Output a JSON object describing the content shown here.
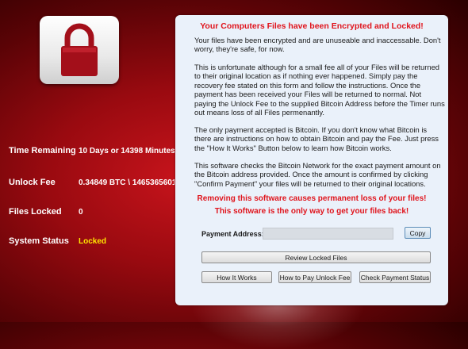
{
  "left_info": {
    "time_remaining": {
      "label": "Time Remaining",
      "value": "10 Days or 14398 Minutes"
    },
    "unlock_fee": {
      "label": "Unlock Fee",
      "value": "0.34849 BTC \\ 1465365601"
    },
    "files_locked": {
      "label": "Files Locked",
      "value": "0"
    },
    "system_status": {
      "label": "System Status",
      "value": "Locked",
      "value_color": "#ffe600"
    }
  },
  "panel": {
    "title": "Your Computers Files have been Encrypted and Locked!",
    "paragraphs": [
      "Your files have been encrypted and are unuseable and inaccessable. Don't worry, they're safe, for now.",
      "This is unfortunate although for a small fee all of your Files will be returned to their original location as if nothing ever happened. Simply pay the recovery fee stated on this form and follow the instructions. Once the payment has been received your Files will be returned to normal. Not paying the Unlock Fee to the supplied Bitcoin Address before the Timer runs out means loss of all Files permenantly.",
      "The only payment accepted is Bitcoin. If you don't know what Bitcoin is there are instructions on how to obtain Bitcoin and pay the Fee. Just press the \"How It Works\" Button below to learn how Bitcoin works.",
      "This software checks the Bitcoin Network for the exact payment amount on the Bitcoin address provided. Once the amount is confirmed by clicking \"Confirm Payment\" your files will be returned to their original locations."
    ],
    "warning_1": "Removing this software causes permanent loss of your files!",
    "warning_2": "This software is the only way to get your files back!",
    "payment_address_label": "Payment Address:",
    "payment_address_value": "",
    "copy_button": "Copy",
    "review_button": "Review Locked Files",
    "how_it_works_button": "How It Works",
    "how_to_pay_button": "How to Pay Unlock Fee",
    "check_payment_button": "Check Payment Status"
  },
  "colors": {
    "title_red": "#e0141c",
    "panel_bg": "#eaf1fa",
    "status_yellow": "#ffe600"
  },
  "icons": {
    "lock": "padlock-icon"
  }
}
